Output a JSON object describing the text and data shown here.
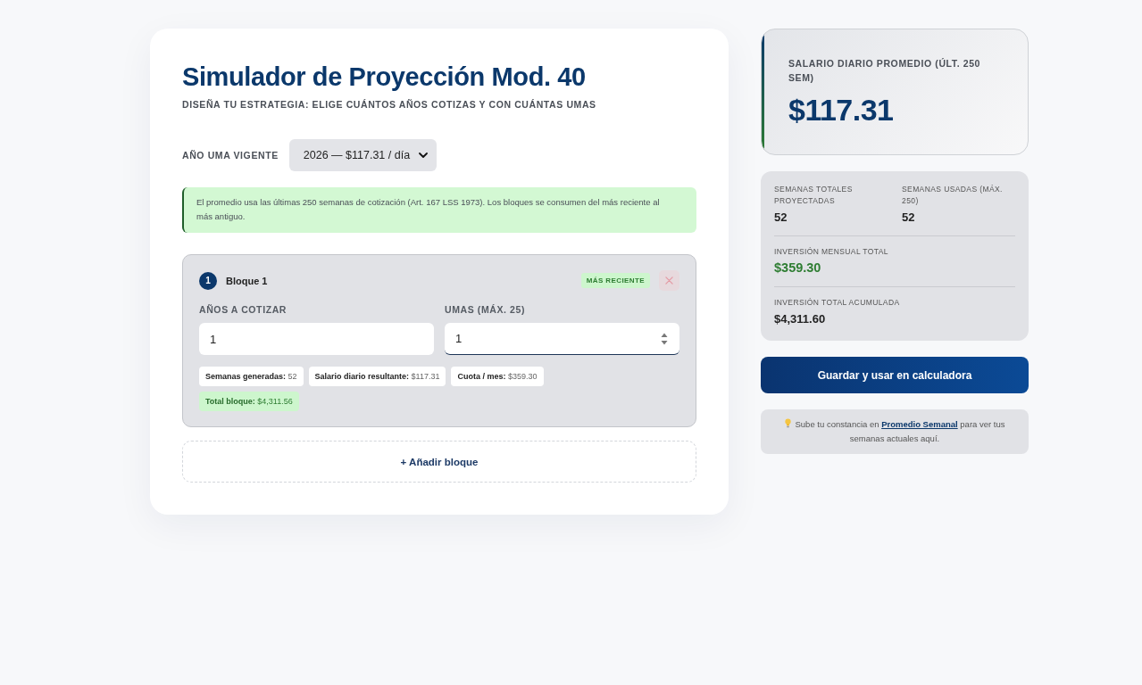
{
  "header": {
    "title": "Simulador de Proyección Mod. 40",
    "subtitle": "DISEÑA TU ESTRATEGIA: ELIGE CUÁNTOS AÑOS COTIZAS Y CON CUÁNTAS UMAS"
  },
  "uma_year": {
    "label": "AÑO UMA VIGENTE",
    "value": "2026 — $117.31 / día"
  },
  "info_note": "El promedio usa las últimas 250 semanas de cotización (Art. 167 LSS 1973). Los bloques se consumen del más reciente al más antiguo.",
  "blocks": [
    {
      "number": "1",
      "title": "Bloque 1",
      "badge": "MÁS RECIENTE",
      "fields": [
        {
          "label": "AÑOS A COTIZAR",
          "value": "1",
          "focused": false
        },
        {
          "label": "UMAS (MÁX. 25)",
          "value": "1",
          "focused": true
        }
      ],
      "metrics": [
        {
          "kind": "detail",
          "label": "Semanas generadas:",
          "value": "52"
        },
        {
          "kind": "detail",
          "label": "Salario diario resultante:",
          "value": "$117.31"
        },
        {
          "kind": "detail",
          "label": "Cuota / mes:",
          "value": "$359.30"
        },
        {
          "kind": "total",
          "label": "Total bloque:",
          "value": "$4,311.56"
        }
      ]
    }
  ],
  "add_block_button": "+ Añadir bloque",
  "average_salary": {
    "label": "SALARIO DIARIO PROMEDIO (ÚLT. 250 SEM)",
    "value": "$117.31"
  },
  "summary": {
    "rows": [
      {
        "stats": [
          {
            "label": "SEMANAS TOTALES PROYECTADAS",
            "value": "52",
            "highlighted": false
          },
          {
            "label": "SEMANAS USADAS (MÁX. 250)",
            "value": "52",
            "highlighted": false
          }
        ]
      },
      {
        "stats": [
          {
            "label": "INVERSIÓN MENSUAL TOTAL",
            "value": "$359.30",
            "highlighted": true
          }
        ]
      },
      {
        "stats": [
          {
            "label": "INVERSIÓN TOTAL ACUMULADA",
            "value": "$4,311.60",
            "highlighted": false
          }
        ]
      }
    ]
  },
  "save_button": "Guardar y usar en calculadora",
  "tip": {
    "text_before": "Sube tu constancia en",
    "link": "Promedio Semanal",
    "text_after": "para ver tus semanas actuales aquí."
  }
}
